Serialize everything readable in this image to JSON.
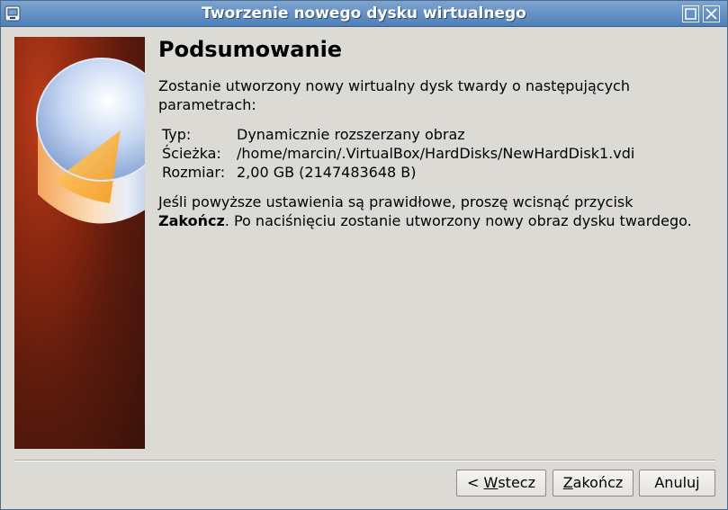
{
  "window": {
    "title": "Tworzenie nowego dysku wirtualnego"
  },
  "summary": {
    "heading": "Podsumowanie",
    "intro": "Zostanie utworzony nowy wirtualny dysk twardy o następujących parametrach:",
    "params": [
      {
        "label": "Typ:",
        "value": "Dynamicznie rozszerzany obraz"
      },
      {
        "label": "Ścieżka:",
        "value": "/home/marcin/.VirtualBox/HardDisks/NewHardDisk1.vdi"
      },
      {
        "label": "Rozmiar:",
        "value": "2,00 GB (2147483648 B)"
      }
    ],
    "note_before": "Jeśli powyższe ustawienia są prawidłowe, proszę wcisnąć przycisk ",
    "note_bold": "Zakończ",
    "note_after": ". Po naciśnięciu zostanie utworzony nowy obraz dysku twardego."
  },
  "buttons": {
    "back_prefix": "< ",
    "back_mnemonic": "W",
    "back_rest": "stecz",
    "finish_mnemonic": "Z",
    "finish_rest": "akończ",
    "cancel": "Anuluj"
  },
  "icons": {
    "app": "virtualbox-app-icon",
    "maximize": "maximize-icon",
    "close": "close-icon"
  },
  "colors": {
    "titlebar": "#5b87bf",
    "side_image_bg": "#7a220f",
    "window_bg": "#dcdad5"
  }
}
